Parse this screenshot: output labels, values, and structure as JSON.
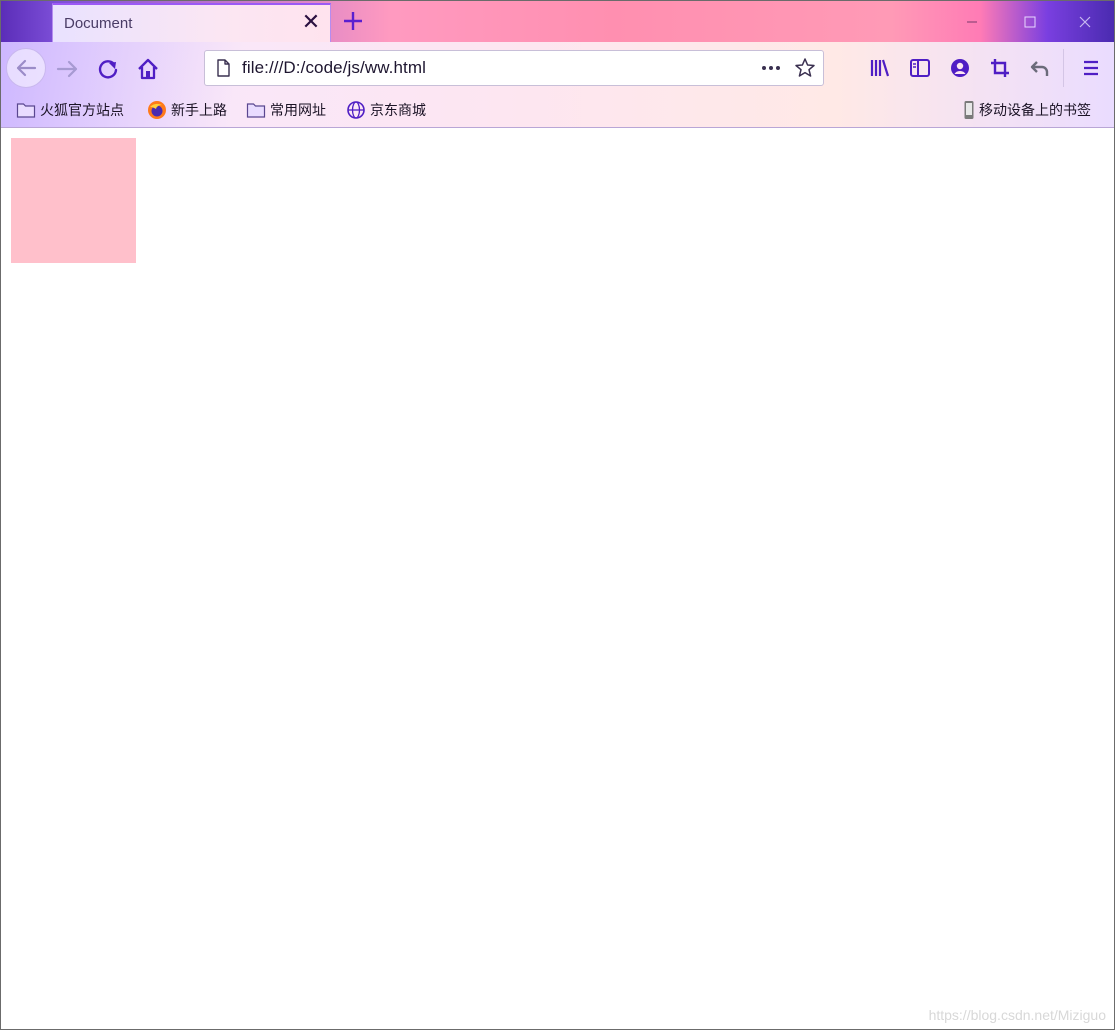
{
  "browser": {
    "tab": {
      "title": "Document",
      "close_glyph": "✕"
    },
    "window_controls": [
      "minimize-icon",
      "maximize-icon",
      "close-icon"
    ]
  },
  "navbar": {
    "url": "file:///D:/code/js/ww.html",
    "buttons": [
      "back-icon",
      "forward-icon",
      "reload-icon",
      "home-icon",
      "page-actions-icon",
      "bookmark-star-icon",
      "library-icon",
      "sidebar-icon",
      "account-icon",
      "screenshot-icon",
      "undo-icon",
      "menu-icon"
    ]
  },
  "bookmarks": {
    "items": [
      {
        "label": "火狐官方站点",
        "icon": "folder-icon"
      },
      {
        "label": "新手上路",
        "icon": "firefox-icon"
      },
      {
        "label": "常用网址",
        "icon": "folder-icon"
      },
      {
        "label": "京东商城",
        "icon": "globe-icon"
      }
    ],
    "mobile": {
      "label": "移动设备上的书签",
      "icon": "phone-icon"
    }
  },
  "page": {
    "box_color": "#ffc0cb",
    "watermark": "https://blog.csdn.net/Miziguo"
  },
  "theme": {
    "accent": "#5b2db8",
    "tab_border": "#9b59f5"
  }
}
